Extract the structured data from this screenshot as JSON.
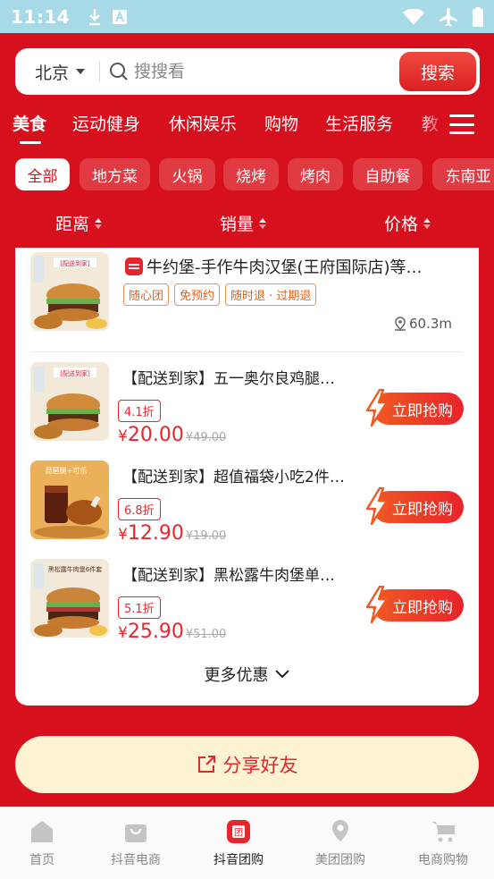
{
  "status_bar": {
    "time": "11:14"
  },
  "search": {
    "city": "北京",
    "placeholder": "搜搜看",
    "button": "搜索"
  },
  "categories": [
    "美食",
    "运动健身",
    "休闲娱乐",
    "购物",
    "生活服务",
    "教"
  ],
  "chips": [
    "全部",
    "地方菜",
    "火锅",
    "烧烤",
    "烤肉",
    "自助餐",
    "东南亚"
  ],
  "sort": {
    "distance": "距离",
    "sales": "销量",
    "price": "价格"
  },
  "store": {
    "title": "牛约堡-手作牛肉汉堡(王府国际店)等…",
    "tags": [
      "随心团",
      "免预约",
      "随时退 · 过期退"
    ],
    "distance": "60.3m",
    "thumb_caption": "[配送到家]"
  },
  "deals": [
    {
      "title": "【配送到家】五一奥尔良鸡腿…",
      "discount": "4.1折",
      "yen": "¥",
      "price": "20.00",
      "original": "¥49.00",
      "button": "立即抢购",
      "thumb_caption": "[配送到家]"
    },
    {
      "title": "【配送到家】超值福袋小吃2件…",
      "discount": "6.8折",
      "yen": "¥",
      "price": "12.90",
      "original": "¥19.00",
      "button": "立即抢购",
      "thumb_caption": "琵琶腿+可乐"
    },
    {
      "title": "【配送到家】黑松露牛肉堡单…",
      "discount": "5.1折",
      "yen": "¥",
      "price": "25.90",
      "original": "¥51.00",
      "button": "立即抢购",
      "thumb_caption": "黑松露牛肉堡6件套"
    }
  ],
  "more": "更多优惠",
  "share": "分享好友",
  "tabs": [
    "首页",
    "抖音电商",
    "抖音团购",
    "美团团购",
    "电商购物"
  ]
}
